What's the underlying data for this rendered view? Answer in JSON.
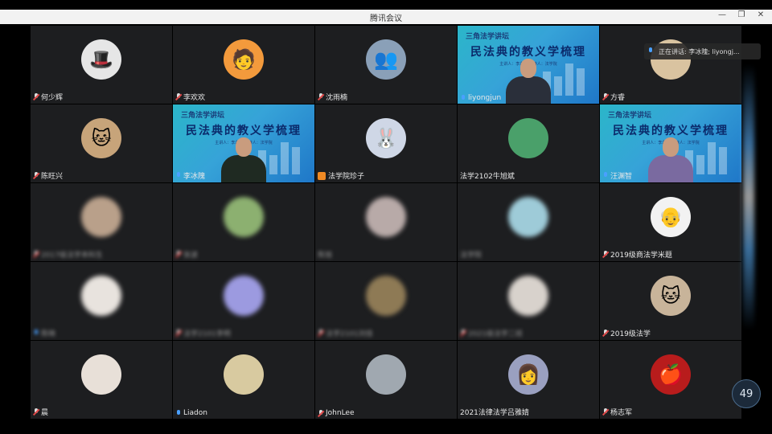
{
  "window": {
    "title": "腾讯会议"
  },
  "speaking": {
    "text": "正在讲话: 李冰隗; liyongj..."
  },
  "participant_count": "49",
  "presentation": {
    "banner": "三角法学讲坛",
    "title": "民法典的教义学梳理",
    "subtitle": "主讲人：李永军 主持人：法学院"
  },
  "tiles": [
    {
      "name": "何少辉",
      "avatar": "🎩",
      "bg": "#e6e6e6",
      "blur": false,
      "mic": "muted"
    },
    {
      "name": "李欢欢",
      "avatar": "🧑",
      "bg": "#f39a3c",
      "blur": false,
      "mic": "muted"
    },
    {
      "name": "沈雨楠",
      "avatar": "👥",
      "bg": "#8aa0b8",
      "blur": false,
      "mic": "muted"
    },
    {
      "name": "liyongjun",
      "type": "slide",
      "mic": "active",
      "suit": "#2a2f3a"
    },
    {
      "name": "方睿",
      "avatar": "",
      "bg": "#d9c3a0",
      "blur": false,
      "mic": "muted"
    },
    {
      "name": "陈旺兴",
      "avatar": "🐱",
      "bg": "#c7a47a",
      "blur": false,
      "mic": "muted"
    },
    {
      "name": "李冰隗",
      "type": "slide",
      "mic": "active",
      "suit": "#1f2a22"
    },
    {
      "name": "法学院珍子",
      "avatar": "🐰",
      "bg": "#cfd7e6",
      "blur": false,
      "mic": "orange"
    },
    {
      "name": "法学2102牛旭斌",
      "avatar": "",
      "bg": "#4aa06a",
      "blur": false,
      "mic": "none"
    },
    {
      "name": "汪渊智",
      "type": "slide",
      "mic": "active",
      "suit": "#7a6aa0"
    },
    {
      "name": "2017级法学本科生",
      "avatar": "",
      "bg": "#b9a08a",
      "blur": true,
      "mic": "muted"
    },
    {
      "name": "张波",
      "avatar": "",
      "bg": "#8cb070",
      "blur": true,
      "mic": "muted"
    },
    {
      "name": "陈旭",
      "avatar": "",
      "bg": "#b8aaa8",
      "blur": true,
      "mic": "none"
    },
    {
      "name": "法学院",
      "avatar": "",
      "bg": "#9ecbd8",
      "blur": true,
      "mic": "none"
    },
    {
      "name": "2019级商法学米题",
      "avatar": "👴",
      "bg": "#f2f2f2",
      "blur": false,
      "mic": "muted"
    },
    {
      "name": "陈晓",
      "avatar": "",
      "bg": "#e8e3de",
      "blur": true,
      "mic": "active"
    },
    {
      "name": "法学2101李明",
      "avatar": "",
      "bg": "#9c9ae0",
      "blur": true,
      "mic": "muted"
    },
    {
      "name": "法学2101刘佳",
      "avatar": "",
      "bg": "#8e7a55",
      "blur": true,
      "mic": "muted"
    },
    {
      "name": "2021级法学二班",
      "avatar": "",
      "bg": "#d8d2cc",
      "blur": true,
      "mic": "muted"
    },
    {
      "name": "2019级法学",
      "avatar": "🐱",
      "bg": "#c8b49a",
      "blur": false,
      "mic": "muted"
    },
    {
      "name": "晨",
      "avatar": "",
      "bg": "#e8e0d8",
      "blur": false,
      "mic": "muted"
    },
    {
      "name": "Liadon",
      "avatar": "",
      "bg": "#d8caa0",
      "blur": false,
      "mic": "active"
    },
    {
      "name": "JohnLee",
      "avatar": "",
      "bg": "#a0a8b0",
      "blur": false,
      "mic": "muted"
    },
    {
      "name": "2021法律法学吕雅婧",
      "avatar": "👩",
      "bg": "#9aa0c0",
      "blur": false,
      "mic": "none"
    },
    {
      "name": "杨志军",
      "avatar": "🍎",
      "bg": "#b81c1c",
      "blur": false,
      "mic": "muted"
    }
  ]
}
